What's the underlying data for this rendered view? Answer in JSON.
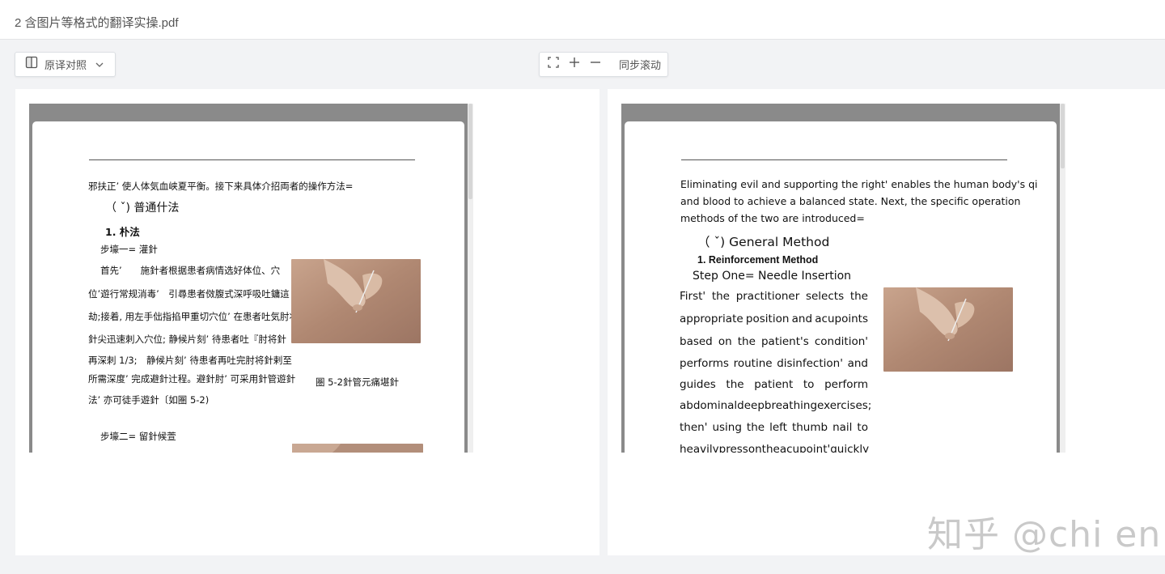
{
  "app": {
    "file_title": "2 含图片等格式的翻译实操.pdf"
  },
  "toolbar": {
    "view_mode_label": "原译对照",
    "sync_scroll_label": "同步滚动",
    "icons": [
      "split-view-icon",
      "chevron-down-icon",
      "fit-screen-icon",
      "zoom-in-icon",
      "zoom-out-icon"
    ]
  },
  "original_page": {
    "intro": "邪扶正’ 使人体気血峡夏平衡。接下来具体介招両者的操作方法=",
    "section": "（ ˇ) 普通什法",
    "heading": "1. 朴法",
    "step1": "步壕一= 灌針",
    "para_lines": [
      "首先’　　施針者根据患者病情选好体位、穴",
      "位’遊行常规消毒’　引尋患者傚腹式深呼吸吐鏞這",
      "劫;接着, 用左手㑁指掐甲重切穴位’ 在患者吐気肘将",
      "針尖迅速刺入穴位; 静候片刻’ 待患者吐『肘将針",
      "再深刺 1/3;　静候片刻’ 待患者再吐完肘将針剌至",
      "所需深度’ 完成避針辻程。避針肘’ 可采用針管遊針",
      "法’ 亦可徒手遊針〔如圏 5-2)"
    ],
    "caption": "圏 5-2針管元痛堪針",
    "step2": "步壕二= 留針候萱"
  },
  "translated_page": {
    "intro_lines": [
      "Eliminating evil and supporting the right' enables the human body's qi",
      "and blood to achieve a balanced state. Next, the specific operation",
      "methods of the two are introduced="
    ],
    "section": "（ ˇ) General Method",
    "heading": "1. Reinforcement Method",
    "step1": "Step One= Needle Insertion",
    "para_lines": [
      [
        "First'",
        "the",
        "practitioner",
        "selects",
        "the"
      ],
      [
        "appropriate",
        "position",
        "and",
        "acupoints"
      ],
      [
        "based",
        "on",
        "the",
        "patient's",
        "condition'"
      ],
      [
        "performs",
        "routine",
        "disinfection'",
        "and"
      ],
      [
        "guides",
        "the",
        "patient",
        "to",
        "perform"
      ],
      [
        "abdominal",
        "deep",
        "breathing",
        "exercises;"
      ],
      [
        "then'",
        "using",
        "the",
        "left",
        "thumb",
        "nail",
        "to"
      ],
      [
        "heavily",
        "press",
        "on",
        "the",
        "acupoint'",
        "quickly"
      ]
    ]
  },
  "watermark": "知乎 @chi en",
  "colors": {
    "background": "#f2f3f5",
    "viewer_gray": "#8a8a8a",
    "panel": "#ffffff",
    "text": "#111111",
    "watermark": "#c9c9c9"
  }
}
